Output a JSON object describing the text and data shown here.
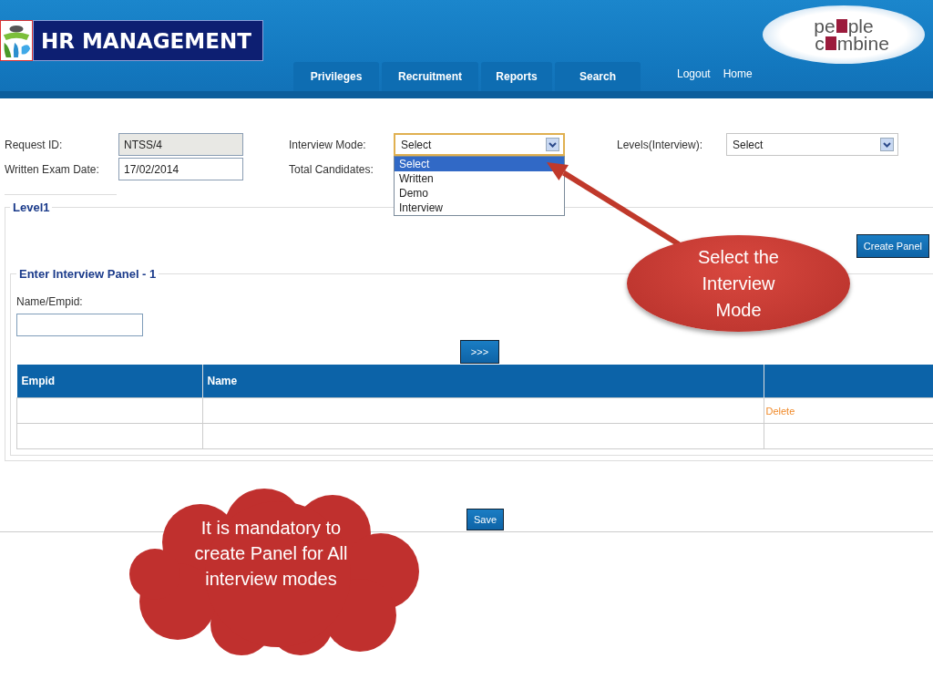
{
  "header": {
    "title": "HR MANAGEMENT",
    "nav_tabs": [
      "Privileges",
      "Recruitment",
      "Reports",
      "Search"
    ],
    "links": [
      "Logout",
      "Home"
    ],
    "partner_logo": [
      {
        "before": "pe",
        "after": "ple"
      },
      {
        "before": "c",
        "after": "mbine"
      }
    ]
  },
  "form": {
    "request_id": {
      "label": "Request ID:",
      "value": "NTSS/4",
      "disabled": true
    },
    "interview_mode": {
      "label": "Interview Mode:",
      "value": "Select",
      "expanded": true,
      "options": [
        {
          "label": "Select",
          "selected": true
        },
        {
          "label": "Written",
          "selected": false
        },
        {
          "label": "Demo",
          "selected": false
        },
        {
          "label": "Interview",
          "selected": false
        }
      ]
    },
    "levels": {
      "label": "Levels(Interview):",
      "value": "Select"
    },
    "written_exam_date": {
      "label": "Written Exam Date:",
      "value": "17/02/2014",
      "disabled": false
    },
    "total_candidates": {
      "label": "Total Candidates:"
    }
  },
  "level_panel": {
    "title": "Level1",
    "create_button": "Create Panel",
    "interview_panel": {
      "title": "Enter Interview Panel - 1",
      "search_label": "Name/Empid:",
      "add_button": ">>>",
      "table": {
        "columns": [
          "Empid",
          "Name"
        ],
        "rows": [
          {
            "action": "Delete"
          },
          {}
        ]
      }
    }
  },
  "save_button": "Save",
  "callouts": [
    {
      "kind": "ellipse",
      "text": "Select the Interview Mode"
    },
    {
      "kind": "cloud",
      "text": "It is mandatory to create Panel for All interview modes"
    }
  ]
}
